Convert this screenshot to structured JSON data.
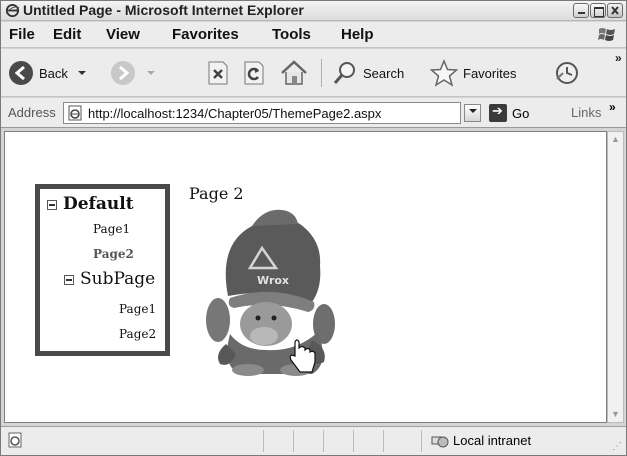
{
  "window": {
    "title": "Untitled Page - Microsoft Internet Explorer"
  },
  "menu": [
    "File",
    "Edit",
    "View",
    "Favorites",
    "Tools",
    "Help"
  ],
  "toolbar": {
    "back_label": "Back",
    "search_label": "Search",
    "favorites_label": "Favorites",
    "more": "»"
  },
  "address": {
    "label": "Address",
    "url": "http://localhost:1234/Chapter05/ThemePage2.aspx",
    "go_label": "Go",
    "links_label": "Links",
    "links_more": "»"
  },
  "tree": {
    "root": "Default",
    "children": [
      "Page1",
      "Page2"
    ],
    "subpage": "SubPage",
    "sub_children": [
      "Page1",
      "Page2"
    ]
  },
  "content": {
    "heading": "Page 2",
    "mascot_text": "Wrox"
  },
  "status": {
    "zone": "Local intranet"
  }
}
